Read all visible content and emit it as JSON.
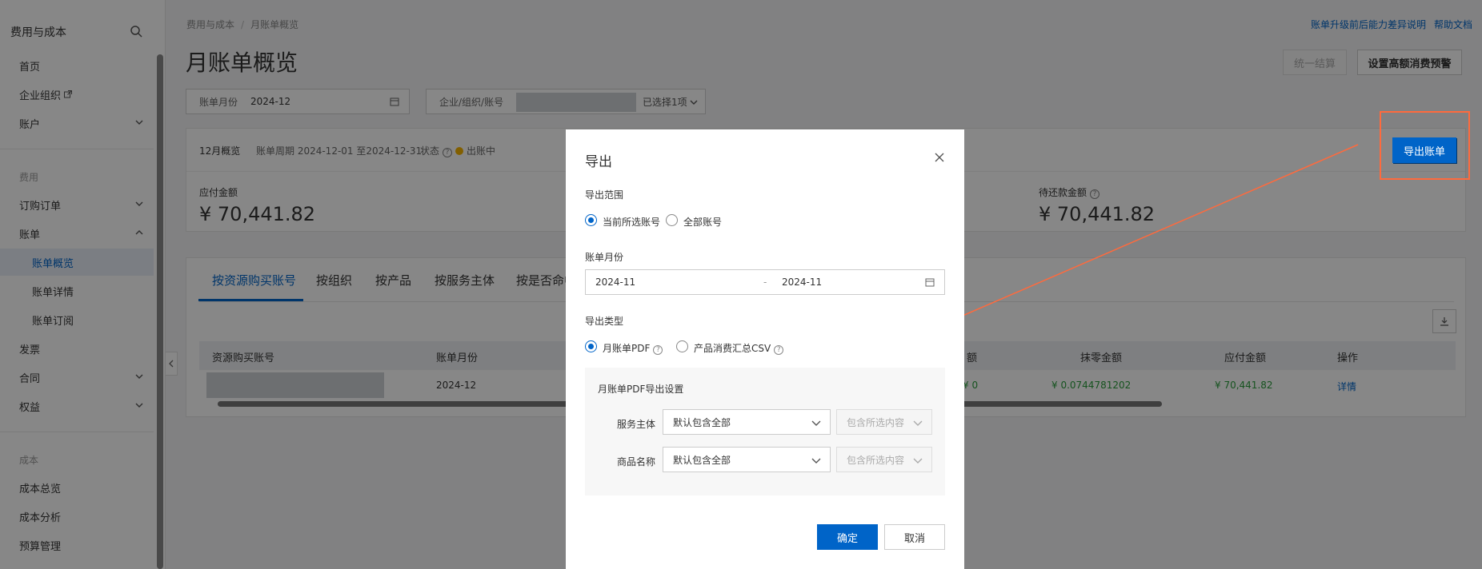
{
  "sidebar": {
    "title": "费用与成本",
    "items": [
      {
        "label": "首页"
      },
      {
        "label": "企业组织"
      },
      {
        "label": "账户"
      },
      {
        "label": "订购订单"
      },
      {
        "label": "账单"
      },
      {
        "label": "账单概览"
      },
      {
        "label": "账单详情"
      },
      {
        "label": "账单订阅"
      },
      {
        "label": "发票"
      },
      {
        "label": "合同"
      },
      {
        "label": "权益"
      },
      {
        "label": "成本总览"
      },
      {
        "label": "成本分析"
      },
      {
        "label": "预算管理"
      }
    ],
    "groups": [
      "费用",
      "成本"
    ]
  },
  "breadcrumb": [
    "费用与成本",
    "月账单概览"
  ],
  "top_links": [
    "账单升级前后能力差异说明",
    "帮助文档"
  ],
  "page_title": "月账单概览",
  "buttons": {
    "unify": "统一结算",
    "alert": "设置高额消费预警",
    "export_bill": "导出账单"
  },
  "filters": {
    "month_label": "账单月份",
    "month_value": "2024-12",
    "org_label": "企业/组织/账号",
    "org_selected": "已选择1项"
  },
  "summary": {
    "month_overview": "12月概览",
    "period": "账单周期 2024-12-01 至2024-12-31",
    "status_label": "状态",
    "status_value": "出账中",
    "payable_label": "应付金额",
    "payable_value": "¥ 70,441.82",
    "outstanding_label": "待还款金额",
    "outstanding_value": "¥ 70,441.82"
  },
  "tabs": [
    "按资源购买账号",
    "按组织",
    "按产品",
    "按服务主体",
    "按是否命中"
  ],
  "table": {
    "headers": [
      "资源购买账号",
      "账单月份",
      "额",
      "抹零金额",
      "应付金额",
      "操作"
    ],
    "row": {
      "month": "2024-12",
      "partial": "¥ 0",
      "rounding": "¥ 0.0744781202",
      "payable": "¥ 70,441.82",
      "action": "详情"
    }
  },
  "modal": {
    "title": "导出",
    "scope_label": "导出范围",
    "scope_options": [
      "当前所选账号",
      "全部账号"
    ],
    "month_label": "账单月份",
    "month_start": "2024-11",
    "month_sep": "-",
    "month_end": "2024-11",
    "type_label": "导出类型",
    "type_options": [
      "月账单PDF",
      "产品消费汇总CSV"
    ],
    "settings_title": "月账单PDF导出设置",
    "service_label": "服务主体",
    "product_label": "商品名称",
    "default_all": "默认包含全部",
    "include_selected": "包含所选内容",
    "confirm": "确定",
    "cancel": "取消"
  },
  "colors": {
    "accent": "#0064c8",
    "annotation": "#ff6a3d",
    "status_dot": "#f5b400",
    "positive": "#2a9d3c"
  }
}
